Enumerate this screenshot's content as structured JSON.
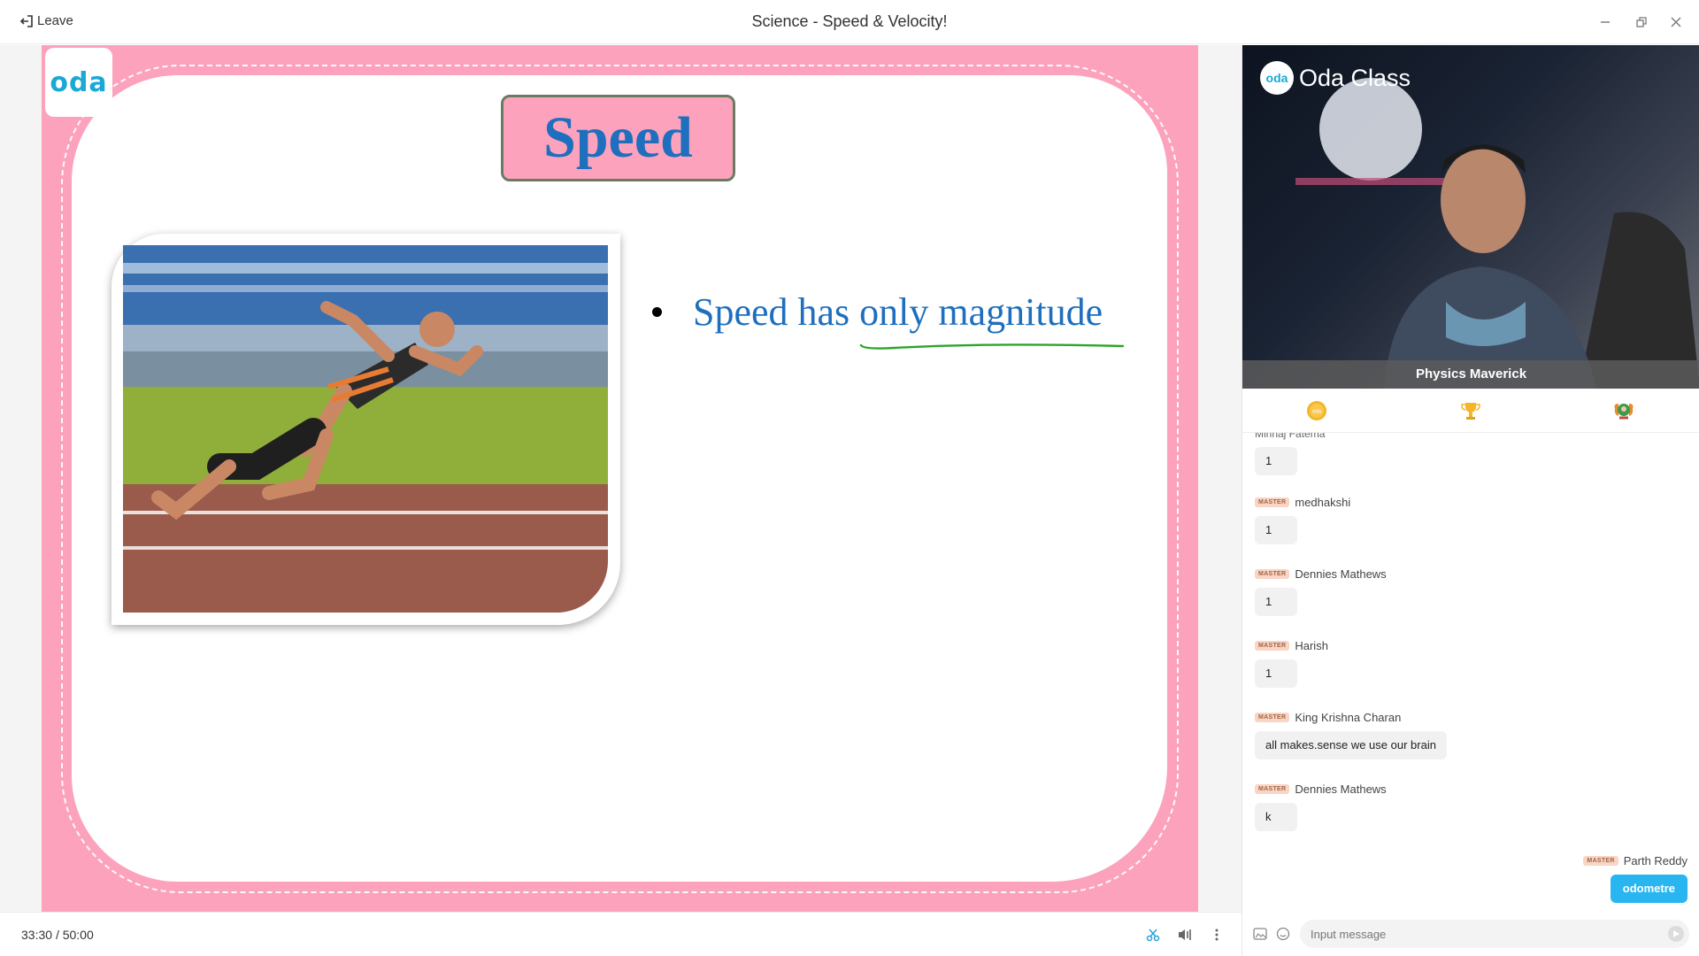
{
  "window": {
    "leave_label": "Leave",
    "title": "Science - Speed & Velocity!"
  },
  "slide": {
    "logo_text": "oda",
    "title": "Speed",
    "bullet": "Speed has only magnitude",
    "colors": {
      "background": "#fca2bd",
      "title_text": "#1e6fbd",
      "annotation": "#2ca52c"
    }
  },
  "player": {
    "elapsed": "33:30",
    "total": "/ 50:00"
  },
  "video": {
    "brand": "Oda Class",
    "brand_badge": "oda",
    "presenter": "Physics Maverick"
  },
  "panel_tabs": [
    "oda-coin-icon",
    "trophy-icon",
    "badge-icon"
  ],
  "chat": {
    "partial_name": "Minhaj Fatema",
    "messages": [
      {
        "badge": "MASTER",
        "name": "medhakshi",
        "text": "1"
      },
      {
        "badge": "MASTER",
        "name": "Dennies Mathews",
        "text": "1"
      },
      {
        "badge": "MASTER",
        "name": "Harish",
        "text": "1"
      },
      {
        "badge": "MASTER",
        "name": "King Krishna Charan",
        "text": "all makes.sense we use our brain"
      },
      {
        "badge": "MASTER",
        "name": "Dennies Mathews",
        "text": "k"
      }
    ],
    "own": {
      "badge": "MASTER",
      "name": "Parth Reddy",
      "text": "odometre"
    },
    "first_text": "1",
    "input_placeholder": "Input message"
  }
}
